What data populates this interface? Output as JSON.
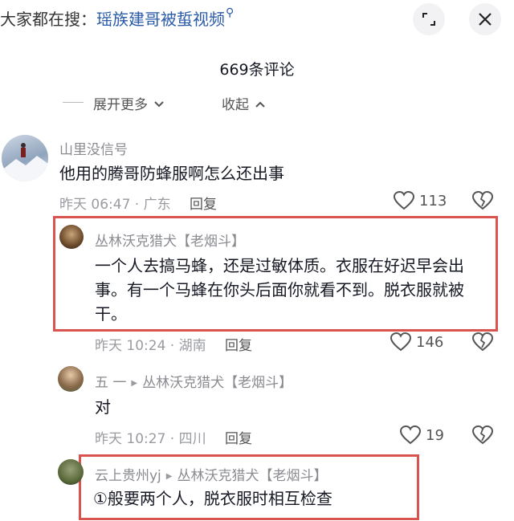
{
  "search": {
    "prefix": "大家都在搜：",
    "term": "瑶族建哥被蜇视频"
  },
  "header": {
    "title": "669条评论"
  },
  "toolbar": {
    "expand_label": "展开更多",
    "collapse_label": "收起"
  },
  "colors": {
    "search_term": "#2a5aa8",
    "highlight_box": "#d9534f",
    "username": "#8a8b91"
  },
  "comments": [
    {
      "user": "山里没信号",
      "text": "他用的腾哥防蜂服啊怎么还出事",
      "time": "昨天 06:47",
      "location": "广东",
      "reply_label": "回复",
      "likes": "113"
    },
    {
      "user": "丛林沃克猎犬【老烟斗】",
      "text": "一个人去搞马蜂，还是过敏体质。衣服在好迟早会出事。有一个马蜂在你头后面你就看不到。脱衣服就被干。",
      "time": "昨天 10:24",
      "location": "湖南",
      "reply_label": "回复",
      "likes": "146"
    },
    {
      "user": "五 一",
      "reply_to": "丛林沃克猎犬【老烟斗】",
      "text": "对",
      "time": "昨天 10:27",
      "location": "四川",
      "reply_label": "回复",
      "likes": "19"
    },
    {
      "user": "云上贵州yj",
      "reply_to": "丛林沃克猎犬【老烟斗】",
      "text": "①般要两个人，脱衣服时相互检查"
    }
  ]
}
